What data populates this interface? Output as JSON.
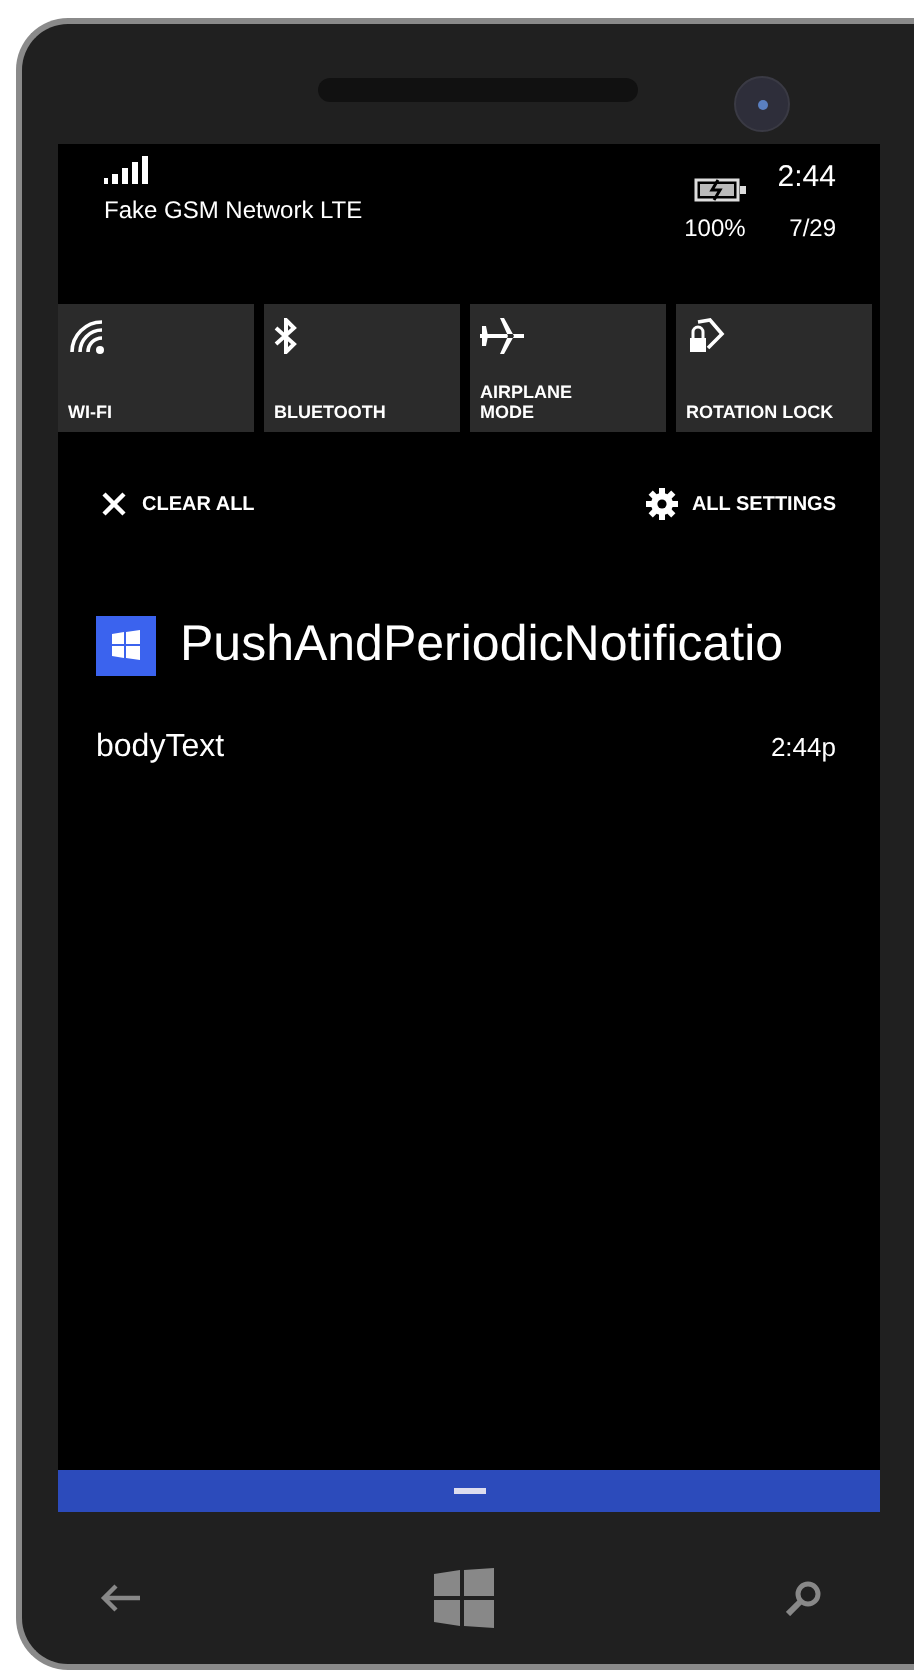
{
  "status_bar": {
    "network": "Fake GSM Network LTE",
    "battery": "100%",
    "time": "2:44",
    "date": "7/29"
  },
  "quick_actions": [
    {
      "label": "WI-FI"
    },
    {
      "label": "BLUETOOTH"
    },
    {
      "label": "AIRPLANE MODE"
    },
    {
      "label": "ROTATION LOCK"
    }
  ],
  "clear_all": "CLEAR ALL",
  "all_settings": "ALL SETTINGS",
  "notifications": [
    {
      "app": "PushAndPeriodicNotificatio",
      "body": "bodyText",
      "time": "2:44p"
    }
  ]
}
